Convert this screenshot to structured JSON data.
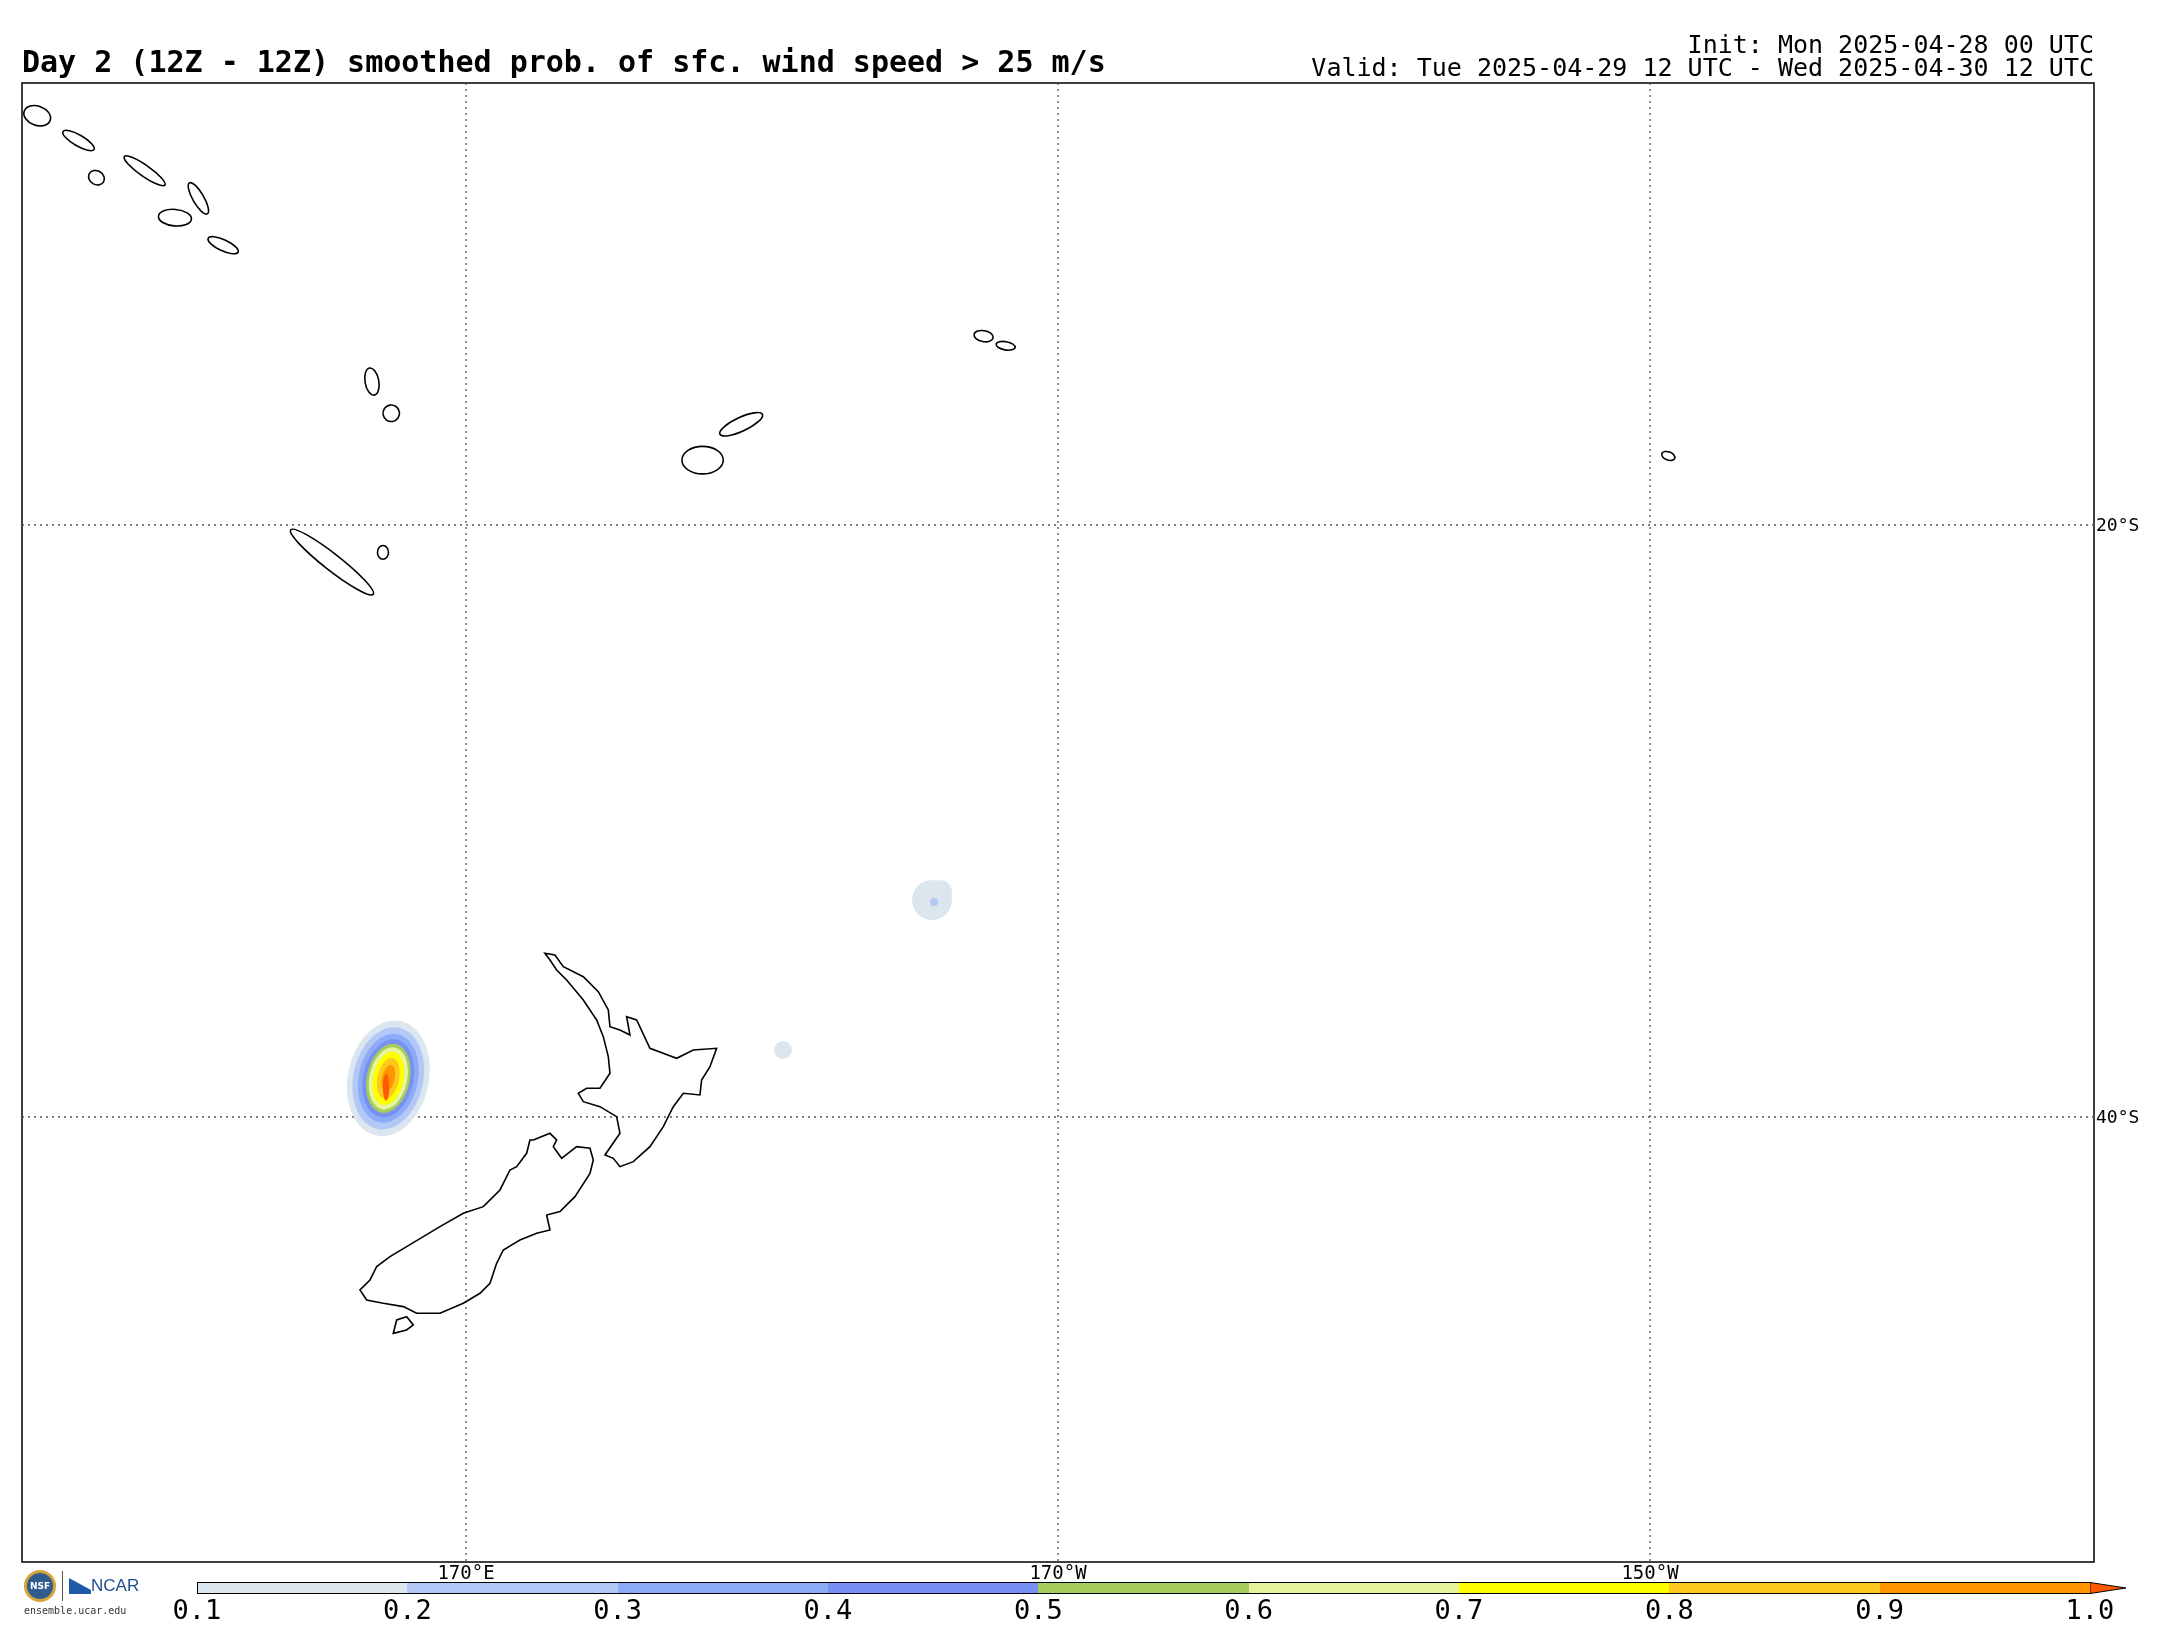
{
  "title": "Day 2 (12Z - 12Z) smoothed prob. of sfc. wind speed > 25 m/s",
  "init": "Init: Mon 2025-04-28 00 UTC",
  "valid": "Valid: Tue 2025-04-29 12 UTC - Wed 2025-04-30 12 UTC",
  "map": {
    "lat_labels": [
      "20°S",
      "40°S"
    ],
    "lon_labels": [
      "170°E",
      "170°W",
      "150°W"
    ]
  },
  "colorbar": {
    "segments": [
      {
        "color": "#dce6ef"
      },
      {
        "color": "#b4c8f8"
      },
      {
        "color": "#8cacf8"
      },
      {
        "color": "#7890f4"
      },
      {
        "color": "#a6cc5c"
      },
      {
        "color": "#e6f59c"
      },
      {
        "color": "#ffff00"
      },
      {
        "color": "#ffc81e"
      },
      {
        "color": "#ff9600"
      },
      {
        "kind": "extension",
        "color": "#ff5a00"
      }
    ],
    "ticks": [
      "0.1",
      "0.2",
      "0.3",
      "0.4",
      "0.5",
      "0.6",
      "0.7",
      "0.8",
      "0.9",
      "1.0"
    ]
  },
  "logo": {
    "seal": "NSF",
    "name": "NCAR",
    "url": "ensemble.ucar.edu"
  }
}
